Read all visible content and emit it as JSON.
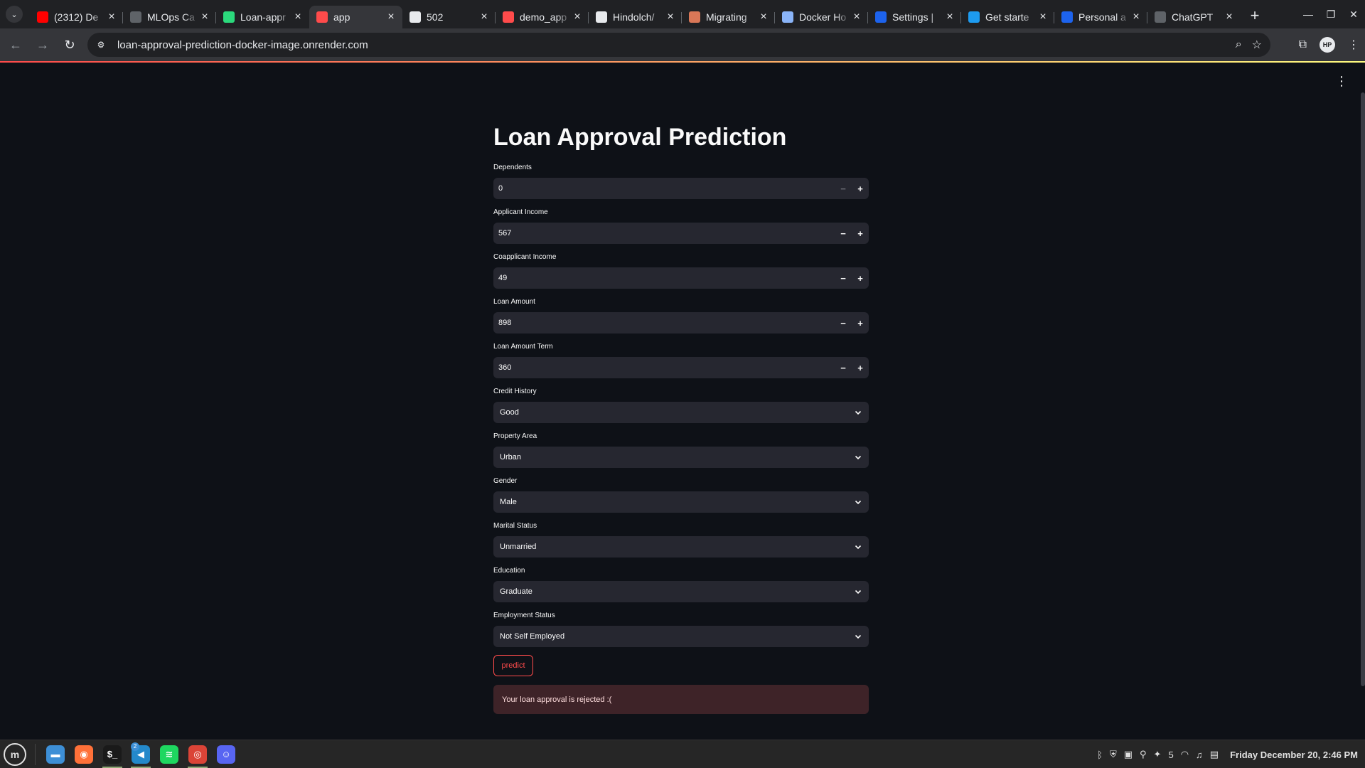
{
  "browser": {
    "tabs": [
      {
        "title": "(2312) De",
        "icon": "youtube-icon",
        "color": "#ff0000",
        "active": false
      },
      {
        "title": "MLOps Ca",
        "icon": "openai-icon",
        "color": "#5f6368",
        "active": false
      },
      {
        "title": "Loan-appr",
        "icon": "render-icon",
        "color": "#2bd97c",
        "active": false
      },
      {
        "title": "app",
        "icon": "streamlit-icon",
        "color": "#ff4b4b",
        "active": true
      },
      {
        "title": "502",
        "icon": "render-icon",
        "color": "#e8eaed",
        "active": false
      },
      {
        "title": "demo_app",
        "icon": "streamlit-icon",
        "color": "#ff4b4b",
        "active": false
      },
      {
        "title": "Hindolch/",
        "icon": "github-icon",
        "color": "#e8eaed",
        "active": false
      },
      {
        "title": "Migrating",
        "icon": "claude-icon",
        "color": "#d97757",
        "active": false
      },
      {
        "title": "Docker Ho",
        "icon": "globe-icon",
        "color": "#8ab4f8",
        "active": false
      },
      {
        "title": "Settings |",
        "icon": "docker-icon",
        "color": "#1d63ed",
        "active": false
      },
      {
        "title": "Get starte",
        "icon": "edge-icon",
        "color": "#1d9bf0",
        "active": false
      },
      {
        "title": "Personal a",
        "icon": "docker-icon",
        "color": "#1d63ed",
        "active": false
      },
      {
        "title": "ChatGPT",
        "icon": "openai-icon",
        "color": "#5f6368",
        "active": false
      }
    ],
    "url": "loan-approval-prediction-docker-image.onrender.com",
    "avatar_initials": "HP"
  },
  "app": {
    "title": "Loan Approval Prediction",
    "number_fields": [
      {
        "label": "Dependents",
        "value": "0",
        "minus_disabled": true
      },
      {
        "label": "Applicant Income",
        "value": "567",
        "minus_disabled": false
      },
      {
        "label": "Coapplicant Income",
        "value": "49",
        "minus_disabled": false
      },
      {
        "label": "Loan Amount",
        "value": "898",
        "minus_disabled": false
      },
      {
        "label": "Loan Amount Term",
        "value": "360",
        "minus_disabled": false
      }
    ],
    "select_fields": [
      {
        "label": "Credit History",
        "value": "Good"
      },
      {
        "label": "Property Area",
        "value": "Urban"
      },
      {
        "label": "Gender",
        "value": "Male"
      },
      {
        "label": "Marital Status",
        "value": "Unmarried"
      },
      {
        "label": "Education",
        "value": "Graduate"
      },
      {
        "label": "Employment Status",
        "value": "Not Self Employed"
      }
    ],
    "predict_label": "predict",
    "result_message": "Your loan approval is rejected :(",
    "accent_color": "#ff4b4b"
  },
  "taskbar": {
    "apps": [
      {
        "name": "files",
        "icon": "folder-icon",
        "color": "#3d8fd6",
        "glyph": "▬",
        "running": false
      },
      {
        "name": "firefox",
        "icon": "firefox-icon",
        "color": "#ff7139",
        "glyph": "◉",
        "running": false
      },
      {
        "name": "terminal",
        "icon": "terminal-icon",
        "color": "#1a1a1a",
        "glyph": "$_",
        "running": true
      },
      {
        "name": "vscode",
        "icon": "vscode-icon",
        "color": "#2489ca",
        "glyph": "◀",
        "running": true,
        "badge": "2"
      },
      {
        "name": "spotify",
        "icon": "spotify-icon",
        "color": "#1ed760",
        "glyph": "≋",
        "running": false
      },
      {
        "name": "chrome",
        "icon": "chrome-icon",
        "color": "#db4437",
        "glyph": "◎",
        "running": true
      },
      {
        "name": "discord",
        "icon": "discord-icon",
        "color": "#5865f2",
        "glyph": "☺",
        "running": false
      }
    ],
    "notification_count": "5",
    "clock": "Friday December 20, 2:46 PM"
  }
}
